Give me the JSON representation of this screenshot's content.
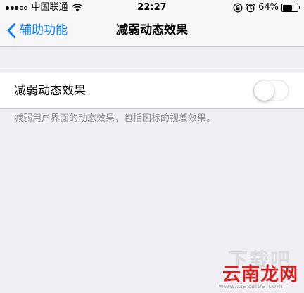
{
  "status_bar": {
    "carrier": "中国联通",
    "time": "22:27",
    "battery_percent": "64%",
    "battery_level": 0.64,
    "icons": [
      "signal-icon",
      "wifi-icon",
      "orientation-lock-icon",
      "alarm-icon",
      "battery-icon"
    ]
  },
  "nav": {
    "back_label": "辅助功能",
    "title": "减弱动态效果"
  },
  "setting": {
    "label": "减弱动态效果",
    "toggle_on": false
  },
  "footer": {
    "text": "减弱用户界面的动态效果，包括图标的视差效果。"
  },
  "watermark": {
    "top": "下载吧",
    "logo": "云南龙网",
    "url": "www.xiazaiba.com"
  },
  "colors": {
    "accent": "#007aff",
    "background": "#efeff4",
    "watermark_red": "#d81e1e"
  }
}
